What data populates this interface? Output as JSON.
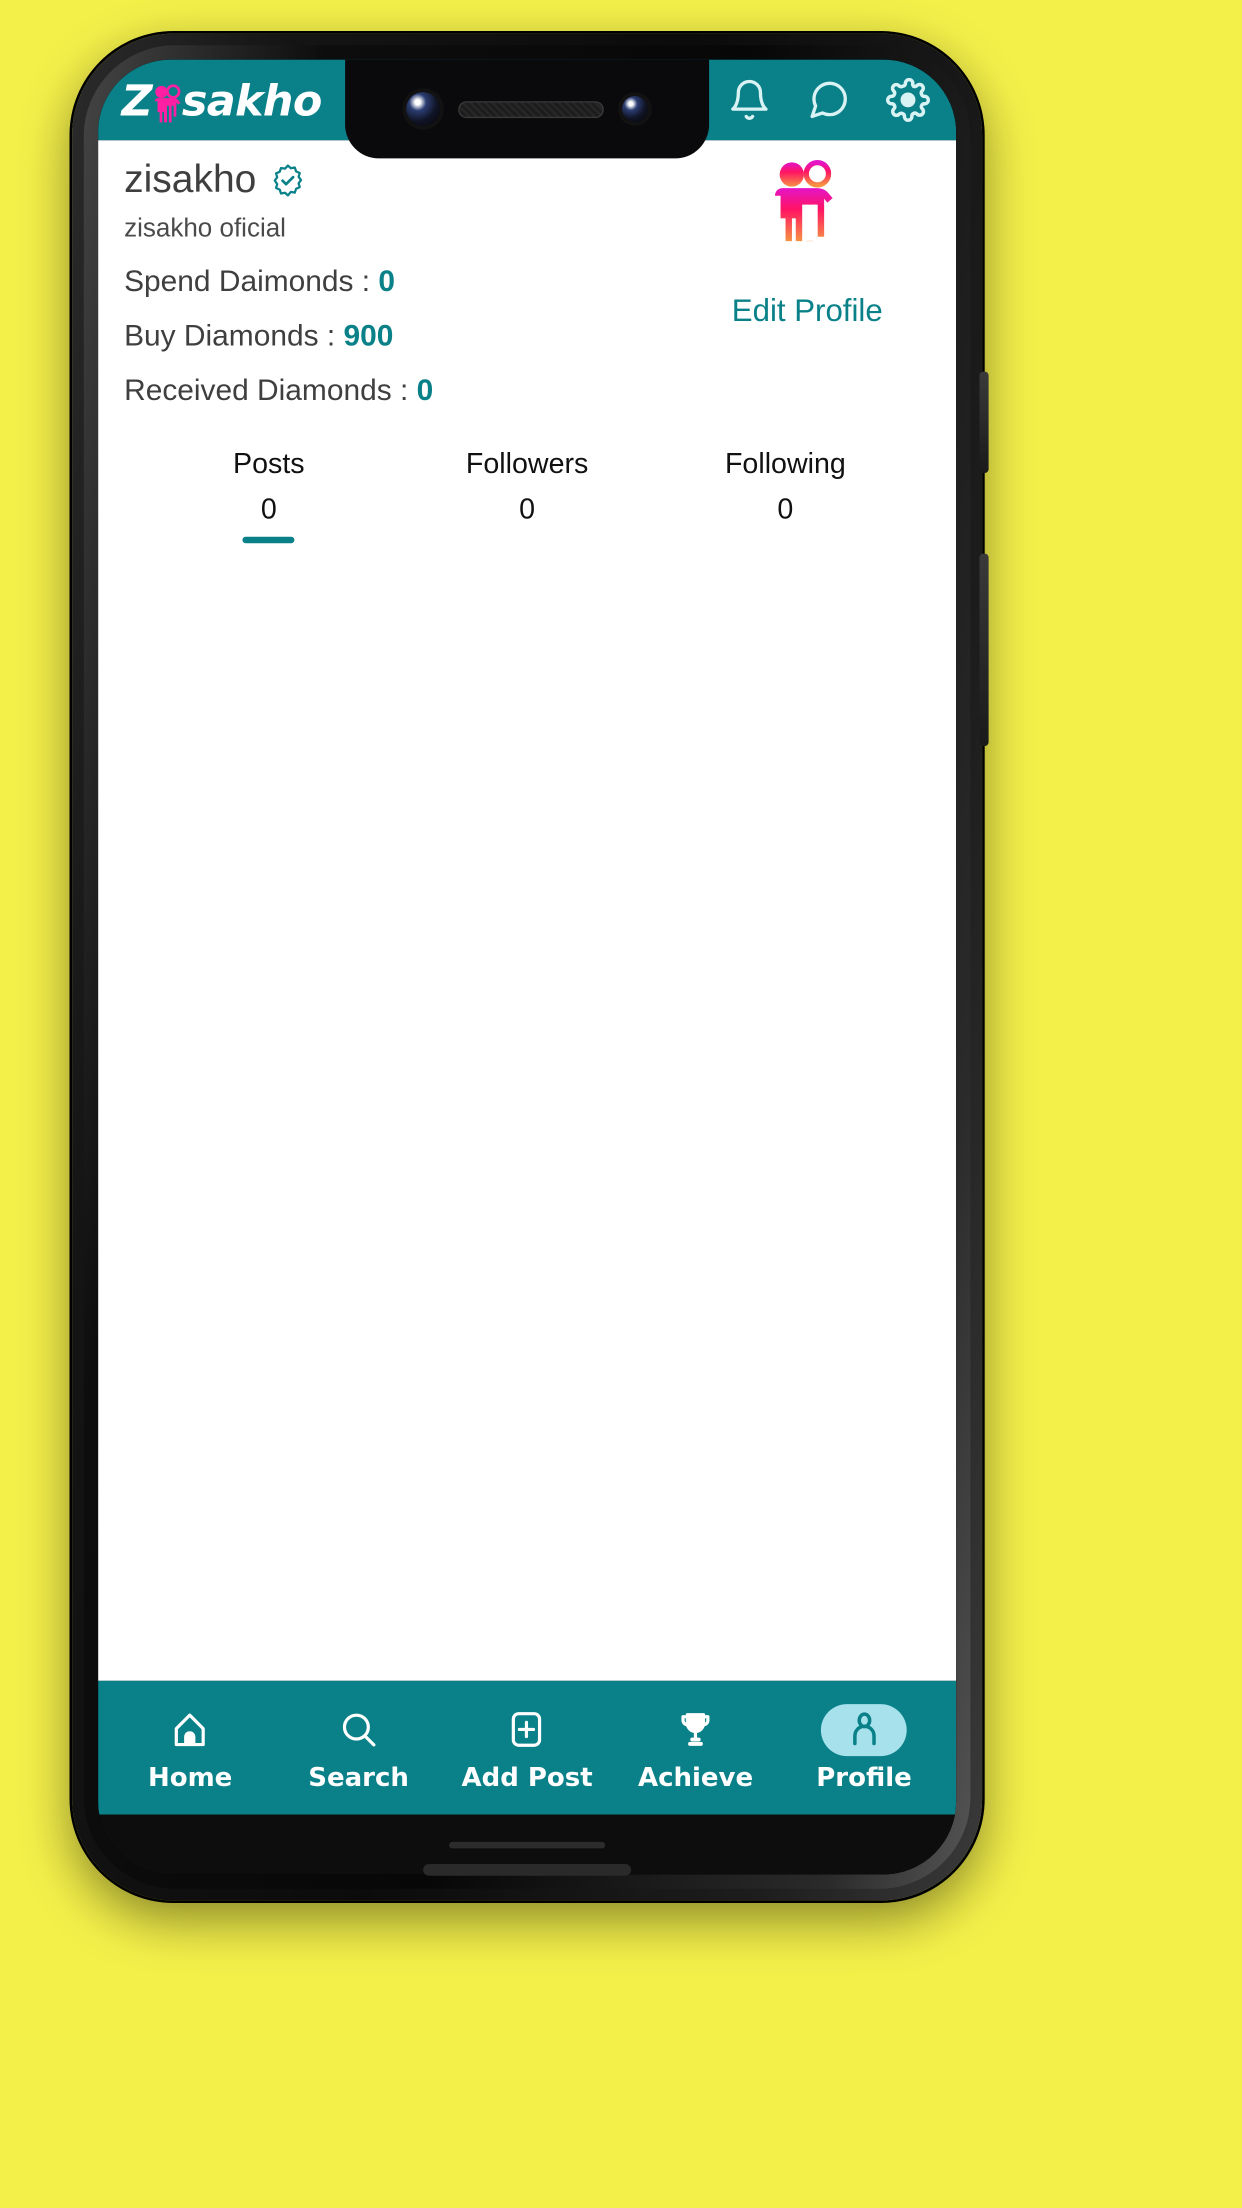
{
  "theme": {
    "background": "#f4f04a",
    "primary_teal": "#0a8189",
    "accent_light_teal": "#a7e1ec",
    "avatar_pink": "#ff1f8e",
    "avatar_magenta": "#e414c8",
    "avatar_orange": "#f88a3d"
  },
  "header": {
    "brand_prefix": "Z",
    "brand_suffix": "sakho",
    "brand_logo_icon": "couple-logo-icon",
    "actions": [
      {
        "name": "notifications-icon",
        "label": "Notifications"
      },
      {
        "name": "messages-icon",
        "label": "Messages"
      },
      {
        "name": "settings-gear-icon",
        "label": "Settings"
      }
    ]
  },
  "profile": {
    "username": "zisakho",
    "verified_badge_icon": "verified-badge-icon",
    "handle": "zisakho oficial",
    "avatar_icon": "couple-avatar-icon",
    "edit_profile_label": "Edit Profile",
    "diamonds": [
      {
        "label": "Spend Daimonds : ",
        "value": "0"
      },
      {
        "label": "Buy Diamonds : ",
        "value": "900"
      },
      {
        "label": "Received Diamonds : ",
        "value": "0"
      }
    ],
    "stats": [
      {
        "label": "Posts",
        "value": "0",
        "active": true
      },
      {
        "label": "Followers",
        "value": "0",
        "active": false
      },
      {
        "label": "Following",
        "value": "0",
        "active": false
      }
    ]
  },
  "bottom_nav": {
    "items": [
      {
        "label": "Home",
        "icon": "home-icon",
        "active": false
      },
      {
        "label": "Search",
        "icon": "search-icon",
        "active": false
      },
      {
        "label": "Add Post",
        "icon": "add-post-icon",
        "active": false
      },
      {
        "label": "Achieve",
        "icon": "trophy-icon",
        "active": false
      },
      {
        "label": "Profile",
        "icon": "person-icon",
        "active": true
      }
    ]
  }
}
